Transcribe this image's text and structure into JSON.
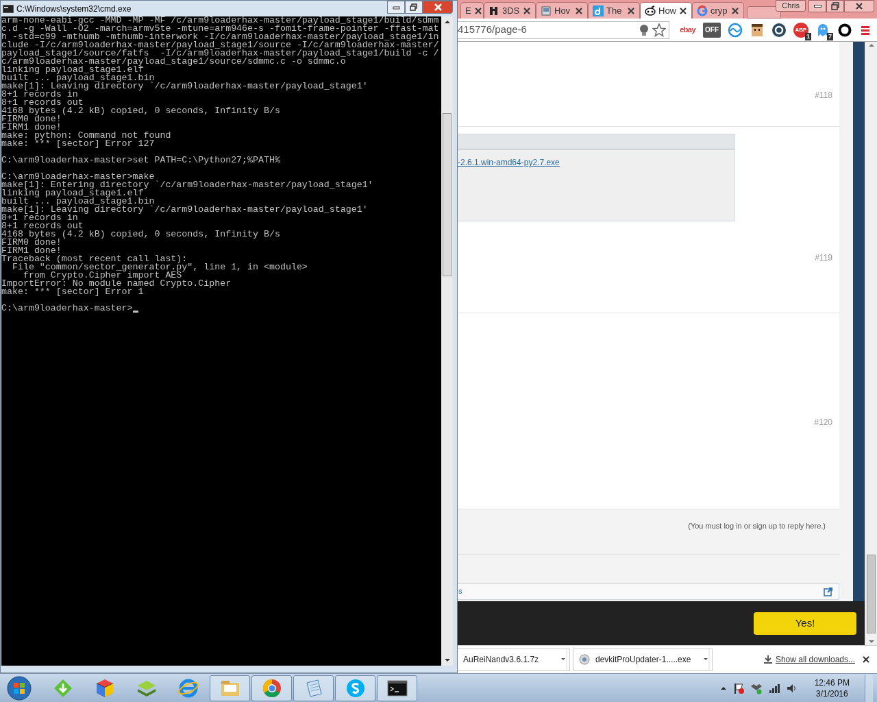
{
  "browser": {
    "tabs": [
      {
        "label": "E",
        "kind": "plain",
        "selected": false
      },
      {
        "label": "3DS",
        "kind": "figure",
        "selected": false
      },
      {
        "label": "Hov",
        "kind": "page",
        "selected": false
      },
      {
        "label": "The",
        "kind": "d",
        "selected": false
      },
      {
        "label": "How",
        "kind": "mascot",
        "selected": true
      },
      {
        "label": "cryp",
        "kind": "g",
        "selected": false
      }
    ],
    "user": "Chris",
    "address": "415776/page-6",
    "extensions": [
      {
        "kind": "ebay",
        "label": "ebay"
      },
      {
        "kind": "toggle",
        "label": "OFF"
      },
      {
        "kind": "wave"
      },
      {
        "kind": "face"
      },
      {
        "kind": "disc"
      },
      {
        "kind": "abp",
        "label": "ABP",
        "badge": "1"
      },
      {
        "kind": "ghost",
        "badge": "7"
      },
      {
        "kind": "ring"
      }
    ],
    "posts": [
      {
        "number": "#118"
      },
      {
        "number": "#119",
        "attachment": {
          "link": "-2.6.1.win-amd64-py2.7.exe"
        }
      },
      {
        "number": "#120"
      }
    ],
    "reply_note": "(You must log in or sign up to reply here.)",
    "breadcrumb": "s",
    "banner_button": "Yes!",
    "downloads": [
      {
        "name": "AuReiNandv3.6.1.7z",
        "kind": "plain"
      },
      {
        "name": "devkitProUpdater-1.....exe",
        "kind": "installer"
      }
    ],
    "show_all": "Show all downloads..."
  },
  "cmd": {
    "title": "C:\\Windows\\system32\\cmd.exe",
    "blocks": [
      [
        "arm-none-eabi-gcc -MMD -MP -MF /c/arm9loaderhax-master/payload_stage1/build/sdmm",
        "c.d -g -Wall -O2 -march=armv5te -mtune=arm946e-s -fomit-frame-pointer -ffast-mat",
        "h -std=c99 -mthumb -mthumb-interwork -I/c/arm9loaderhax-master/payload_stage1/in",
        "clude -I/c/arm9loaderhax-master/payload_stage1/source -I/c/arm9loaderhax-master/",
        "payload_stage1/source/fatfs  -I/c/arm9loaderhax-master/payload_stage1/build -c /",
        "c/arm9loaderhax-master/payload_stage1/source/sdmmc.c -o sdmmc.o",
        "linking payload_stage1.elf",
        "built ... payload_stage1.bin",
        "make[1]: Leaving directory `/c/arm9loaderhax-master/payload_stage1'",
        "8+1 records in",
        "8+1 records out",
        "4168 bytes (4.2 kB) copied, 0 seconds, Infinity B/s",
        "FIRM0 done!",
        "FIRM1 done!",
        "make: python: Command not found",
        "make: *** [sector] Error 127"
      ],
      [
        "C:\\arm9loaderhax-master>set PATH=C:\\Python27;%PATH%"
      ],
      [
        "C:\\arm9loaderhax-master>make",
        "make[1]: Entering directory `/c/arm9loaderhax-master/payload_stage1'",
        "linking payload_stage1.elf",
        "built ... payload_stage1.bin",
        "make[1]: Leaving directory `/c/arm9loaderhax-master/payload_stage1'",
        "8+1 records in",
        "8+1 records out",
        "4168 bytes (4.2 kB) copied, 0 seconds, Infinity B/s",
        "FIRM0 done!",
        "FIRM1 done!",
        "Traceback (most recent call last):",
        "  File \"common/sector_generator.py\", line 1, in <module>",
        "    from Crypto.Cipher import AES",
        "ImportError: No module named Crypto.Cipher",
        "make: *** [sector] Error 1"
      ],
      [
        "C:\\arm9loaderhax-master>"
      ]
    ],
    "cursor": true
  },
  "taskbar": {
    "apps": [
      {
        "kind": "download",
        "active": false
      },
      {
        "kind": "cube",
        "active": false
      },
      {
        "kind": "layers",
        "active": false
      },
      {
        "kind": "ie",
        "active": false
      },
      {
        "kind": "folder",
        "active": true
      },
      {
        "kind": "chrome",
        "active": true
      },
      {
        "kind": "notepad",
        "active": true
      },
      {
        "kind": "skype",
        "active": true
      },
      {
        "kind": "console",
        "active": true
      }
    ],
    "time": "12:46 PM",
    "date": "3/1/2016"
  }
}
